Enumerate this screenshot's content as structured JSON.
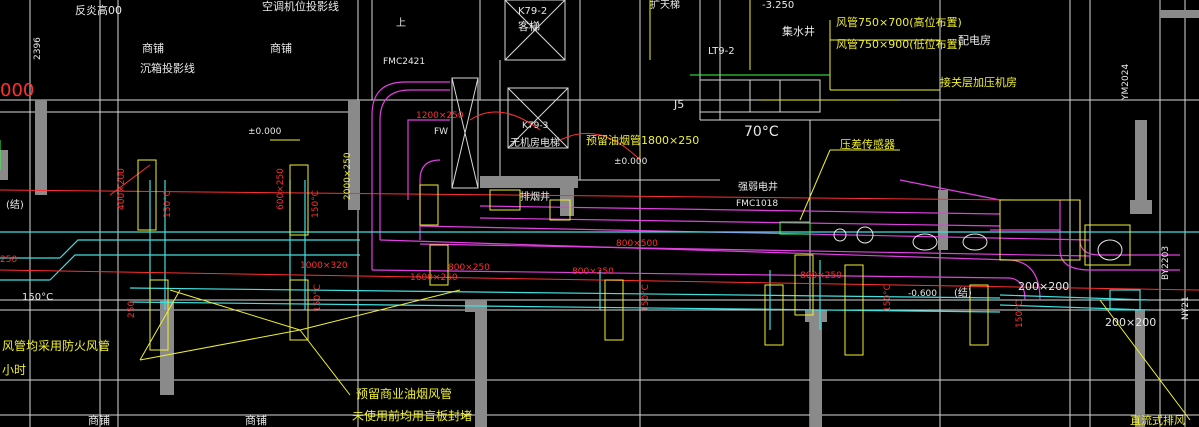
{
  "title": "",
  "colors": {
    "background": "#000000",
    "wall": "#8a8a8a",
    "duct_magenta": "#e040e0",
    "duct_cyan": "#40e0e0",
    "leader_yellow": "#f0f030",
    "annotation_red": "#ff3030",
    "grid_white": "#e8e8e8",
    "green": "#40ff40"
  },
  "labels": {
    "top_reflection": "反炎高00",
    "ac_projection": "空调机位投影线",
    "lift_k79": "K79-2",
    "passenger_lift": "客梯",
    "expansion_well": "扩天梯",
    "elev_neg_3250": "-3.250",
    "collector_well": "集水井",
    "duct_750x700": "风管750×700(高位布置)",
    "duct_750x900": "风管750×900(低位布置)",
    "distribution_room": "配电房",
    "lt9": "LT9-2",
    "shop_left": "商铺",
    "shop_center": "商铺",
    "settle_line": "沉箱投影线",
    "fmc_left": "FMC2421",
    "upper": "上",
    "zero_left": "±0.000",
    "k7": "K79-3",
    "no_machine_room": "无机房电梯",
    "reserved_smoke_duct": "预留油烟管1800×250",
    "zero_center": "±0.000",
    "smoke_exhaust_shaft": "排烟井",
    "temp_70": "70°C",
    "floor_press_room": "接关层加压机房",
    "pressure_sensor": "压差传感器",
    "weak_current_well": "强弱电井",
    "fmc_right": "FMC1018",
    "j5": "J5",
    "fw": "FW",
    "jie_left": "(结)",
    "jie_right": "(结)",
    "elev_neg_0600": "-0.600",
    "d2000x250": "2000×250",
    "d800x500": "800×500",
    "d1000x320": "1000×320",
    "d1600x250": "1600×250",
    "d800x250_a": "800×250",
    "d800x250_b": "800×250",
    "d800x250_c": "800×250",
    "d1200x250": "1200×250",
    "d200x200_a": "200×200",
    "d200x200_b": "200×200",
    "d250_left": "250",
    "d250_side": "250",
    "temp_150_a": "150°C",
    "temp_150_b": "150°C",
    "temp_150_c": "150°C",
    "temp_150_d": "150°C",
    "temp_150_e": "150°C",
    "temp_150_f": "150°C",
    "temp_150_g": "150°C",
    "fire_damper_note": "风管均采用防火风管",
    "hour_note": "小时",
    "reserved_commercial": "预留商业油烟风管",
    "seal_note": "未使用前均用盲板封堵",
    "shop_bottom": "商铺",
    "shop_bottom_right": "商铺",
    "direct_exhaust": "直流式排风",
    "dim_2396": "2396",
    "dim_y2024": "YM2024",
    "dim_by2203": "BY2203",
    "dim_ny21": "NY21",
    "red_left": "000",
    "d400x200": "400×200",
    "d600x250": "600×250"
  }
}
